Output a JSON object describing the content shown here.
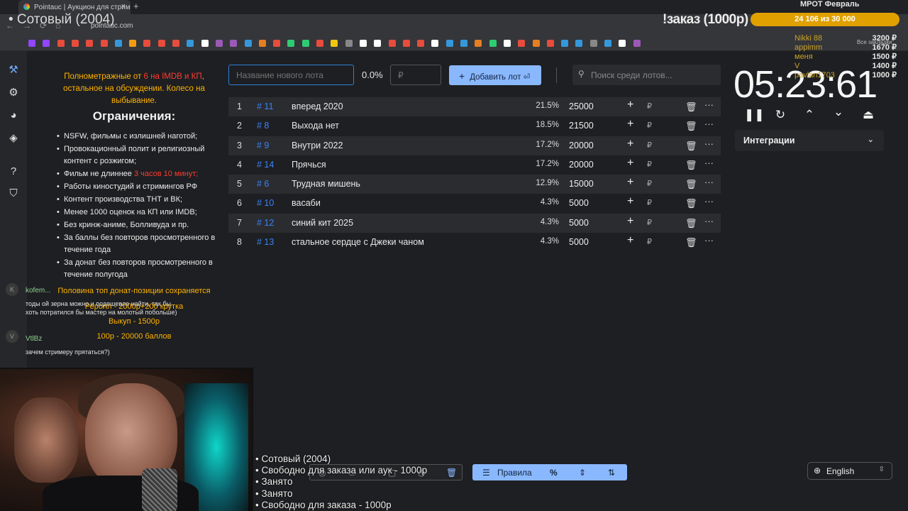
{
  "browser": {
    "tab_title": "Pointauc | Аукцион для стрима",
    "tab_close": "×",
    "new_tab": "+",
    "url": "pointauc.com",
    "all_bookmarks": "Все закладки"
  },
  "overlay": {
    "now_playing_title": "• Сотовый (2004)",
    "top_right_label": "МРОТ Февраль",
    "order_text": "!заказ (1000р)",
    "goal_text": "24 106  из 30 000",
    "donors": [
      "Nikki 88",
      "appimm",
      "меня",
      "V",
      "pavlan1703"
    ],
    "donor_amounts": [
      "3200 ₽",
      "1670 ₽",
      "1500 ₽",
      "1400 ₽",
      "1000 ₽"
    ],
    "status_list": [
      "Сотовый (2004)",
      "Свободно для заказа или аук - 1000р",
      "Занято",
      "Занято",
      "Свободно для заказа - 1000р"
    ]
  },
  "rules": {
    "intro_a": "Полнометражные от ",
    "intro_red": "6 на IMDB и КП",
    "intro_b": ", остальное на обсуждении. Колесо на выбывание.",
    "title": "Ограничения:",
    "items": [
      "NSFW, фильмы с излишней наготой;",
      "Провокационный полит и религиозный контент с розжигом;",
      "Фильм не длиннее ",
      "Работы киностудий и стримингов РФ",
      "Контент производства ТНТ и ВК;",
      "Менее 1000 оценок на КП или IMDB;",
      "Без кринж-аниме, Болливуда и пр.",
      "За баллы без повторов просмотренного в течение года",
      "За донат без повторов просмотренного в течение полугода"
    ],
    "length_red": "3 часов 10 минут;",
    "extra": [
      "Половина топ донат-позиции сохраняется",
      "Реролл - 2000р+200 крутка",
      "Выкуп - 1500р",
      "100р - 20000 баллов"
    ]
  },
  "chat": [
    {
      "avatar": "K",
      "name": "kofem...",
      "text": "тоды ой зерна можно и подешевле найти, так бы хоть потратился бы мастер на молотый побольше)"
    },
    {
      "avatar": "V",
      "name": "VtlBz",
      "text": "зачем стримеру прятаться?)"
    }
  ],
  "lot_bar": {
    "name_placeholder": "Название нового лота",
    "percent": "0.0%",
    "price_placeholder": "₽",
    "add_label": "Добавить лот",
    "add_icon": "⏎",
    "search_placeholder": "Поиск среди лотов..."
  },
  "lots": [
    {
      "idx": "1",
      "num": "# 11",
      "name": "вперед 2020",
      "pct": "21.5%",
      "amount": "25000"
    },
    {
      "idx": "2",
      "num": "# 8",
      "name": "Выхода нет",
      "pct": "18.5%",
      "amount": "21500"
    },
    {
      "idx": "3",
      "num": "# 9",
      "name": "Внутри 2022",
      "pct": "17.2%",
      "amount": "20000"
    },
    {
      "idx": "4",
      "num": "# 14",
      "name": "Прячься",
      "pct": "17.2%",
      "amount": "20000"
    },
    {
      "idx": "5",
      "num": "# 6",
      "name": "Трудная мишень",
      "pct": "12.9%",
      "amount": "15000"
    },
    {
      "idx": "6",
      "num": "# 10",
      "name": "васаби",
      "pct": "4.3%",
      "amount": "5000"
    },
    {
      "idx": "7",
      "num": "# 12",
      "name": "синий кит 2025",
      "pct": "4.3%",
      "amount": "5000"
    },
    {
      "idx": "8",
      "num": "# 13",
      "name": "стальное сердце с Джеки чаном",
      "pct": "4.3%",
      "amount": "5000"
    }
  ],
  "row_icons": {
    "plus": "+",
    "rub": "₽",
    "delete": "🗑",
    "more": "···"
  },
  "timer": {
    "value": "05:23:61",
    "integrations_label": "Интеграции"
  },
  "bottom": {
    "rules_label": "Правила",
    "percent_icon": "%",
    "language": "English"
  },
  "colors": {
    "accent": "#8ab8ff",
    "lot_number": "#3b82f6",
    "warning_red": "#ff3b30",
    "highlight_orange": "#ffb300",
    "goal_bar": "#e0a000"
  }
}
